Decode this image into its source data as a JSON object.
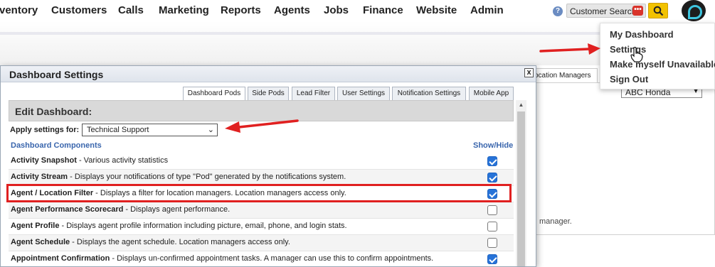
{
  "nav": {
    "items": [
      "ventory",
      "Customers",
      "Calls",
      "Marketing",
      "Reports",
      "Agents",
      "Jobs",
      "Finance",
      "Website",
      "Admin"
    ],
    "customer_search": "Customer Search",
    "help_icon": "?"
  },
  "user_menu": {
    "items": [
      "My Dashboard",
      "Settings",
      "Make myself Unavailable",
      "Sign Out"
    ]
  },
  "background": {
    "tab_label": "ocation Managers",
    "select_value": "ABC Honda",
    "text": "manager."
  },
  "dialog": {
    "title": "Dashboard Settings",
    "close_label": "x",
    "tabs": [
      "Dashboard Pods",
      "Side Pods",
      "Lead Filter",
      "User Settings",
      "Notification Settings",
      "Mobile App"
    ],
    "active_tab": "Dashboard Pods",
    "section_title": "Edit Dashboard:",
    "apply_label": "Apply settings for:",
    "apply_value": "Technical Support",
    "col_components": "Dashboard Components",
    "col_showhide": "Show/Hide",
    "rows": [
      {
        "name": "Activity Snapshot",
        "desc": " - Various activity statistics",
        "checked": true
      },
      {
        "name": "Activity Stream",
        "desc": " - Displays your notifications of type \"Pod\" generated by the notifications system.",
        "checked": true
      },
      {
        "name": "Agent / Location Filter",
        "desc": " - Displays a filter for location managers. Location managers access only.",
        "checked": true
      },
      {
        "name": "Agent Performance Scorecard",
        "desc": " - Displays agent performance.",
        "checked": false
      },
      {
        "name": "Agent Profile",
        "desc": " - Displays agent profile information including picture, email, phone, and login stats.",
        "checked": false
      },
      {
        "name": "Agent Schedule",
        "desc": " - Displays the agent schedule. Location managers access only.",
        "checked": false
      },
      {
        "name": "Appointment Confirmation",
        "desc": " - Displays un-confirmed appointment tasks. A manager can use this to confirm appointments.",
        "checked": true
      }
    ]
  },
  "colors": {
    "accent": "#2773d8",
    "annotation_red": "#e02020",
    "search_button": "#f2c200"
  }
}
